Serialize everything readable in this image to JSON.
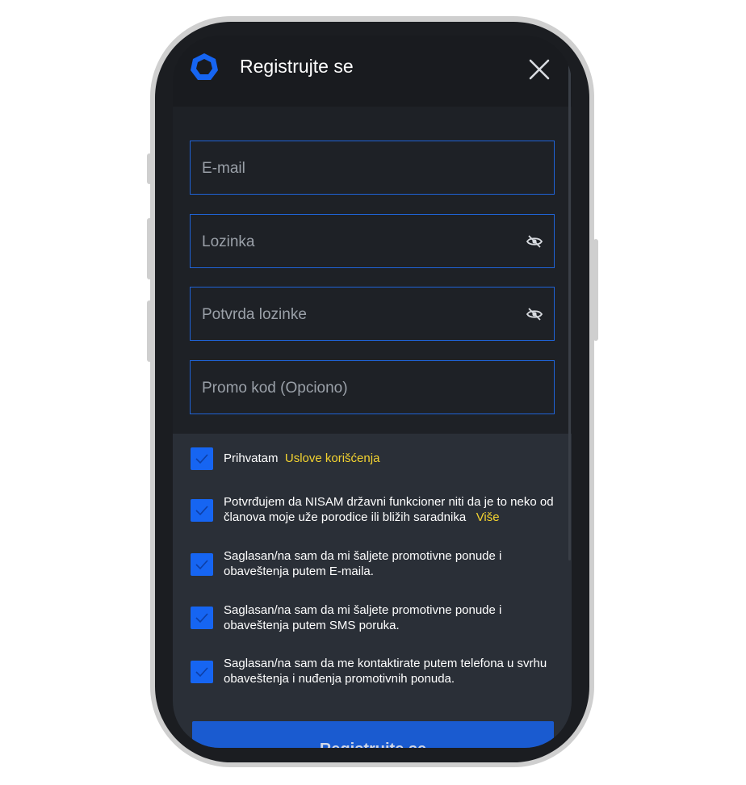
{
  "header": {
    "title": "Registrujte se",
    "logo_icon": "hexagon-ring-icon",
    "close_icon": "close-icon"
  },
  "form": {
    "email_label": "E-mail",
    "password_label": "Lozinka",
    "password_confirm_label": "Potvrda lozinke",
    "promo_label": "Promo kod (Opciono)",
    "toggle_visibility_icon": "eye-slash-icon"
  },
  "consents": {
    "terms": {
      "text": "Prihvatam",
      "link": "Uslove korišćenja",
      "checked": true
    },
    "pep": {
      "text": "Potvrđujem da NISAM državni funkcioner niti da je to neko od članova moje uže porodice ili bližih saradnika",
      "link": "Više",
      "checked": true
    },
    "email_promo": {
      "text": "Saglasan/na sam da mi šaljete promotivne ponude i obaveštenja putem E-maila.",
      "checked": true
    },
    "sms_promo": {
      "text": "Saglasan/na sam da mi šaljete promotivne ponude i obaveštenja putem SMS poruka.",
      "checked": true
    },
    "phone_contact": {
      "text": "Saglasan/na sam da me kontaktirate putem telefona u svrhu obaveštenja i nuđenja promotivnih ponuda.",
      "checked": true
    }
  },
  "submit": {
    "label": "Registrujte se"
  },
  "colors": {
    "accent": "#1665f2",
    "link": "#f3d330",
    "background": "#1e2126",
    "panel": "#2a2f37"
  }
}
